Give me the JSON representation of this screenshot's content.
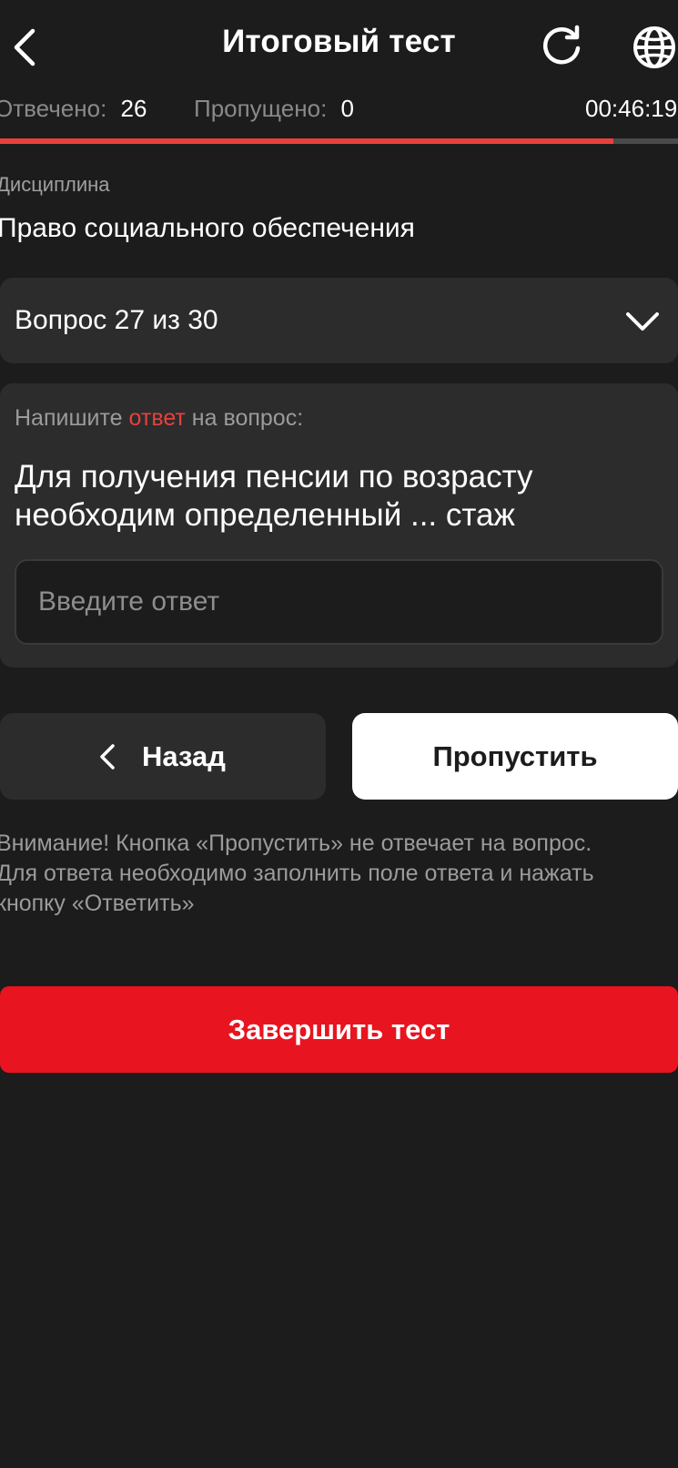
{
  "header": {
    "title": "Итоговый тест",
    "back_icon": "chevron-left-icon",
    "reload_icon": "reload-icon",
    "language_icon": "globe-icon"
  },
  "stats": {
    "answered_label": "Отвечено:",
    "answered_value": "26",
    "skipped_label": "Пропущено:",
    "skipped_value": "0",
    "timer": "00:46:19"
  },
  "progress": {
    "fraction": 0.905,
    "color": "#e8413c"
  },
  "discipline": {
    "label": "Дисциплина",
    "value": "Право социального обеспечения"
  },
  "question_selector": {
    "label": "Вопрос 27 из 30",
    "icon": "chevron-down-icon"
  },
  "question": {
    "prompt_before": "Напишите ",
    "prompt_accent": "ответ",
    "prompt_after": " на вопрос:",
    "text": "Для получения пенсии по возрасту необходим определенный ... стаж",
    "input_placeholder": "Введите ответ",
    "input_value": ""
  },
  "buttons": {
    "back_label": "Назад",
    "skip_label": "Пропустить",
    "finish_label": "Завершить тест"
  },
  "warning": {
    "lines": [
      "Внимание! Кнопка «Пропустить» не отвечает на вопрос.",
      "Для ответа необходимо заполнить поле ответа и нажать",
      "кнопку «Ответить»"
    ]
  },
  "colors": {
    "background": "#1c1c1c",
    "card": "#2c2c2c",
    "accent": "#e8413c",
    "finish_button": "#e8141f"
  }
}
